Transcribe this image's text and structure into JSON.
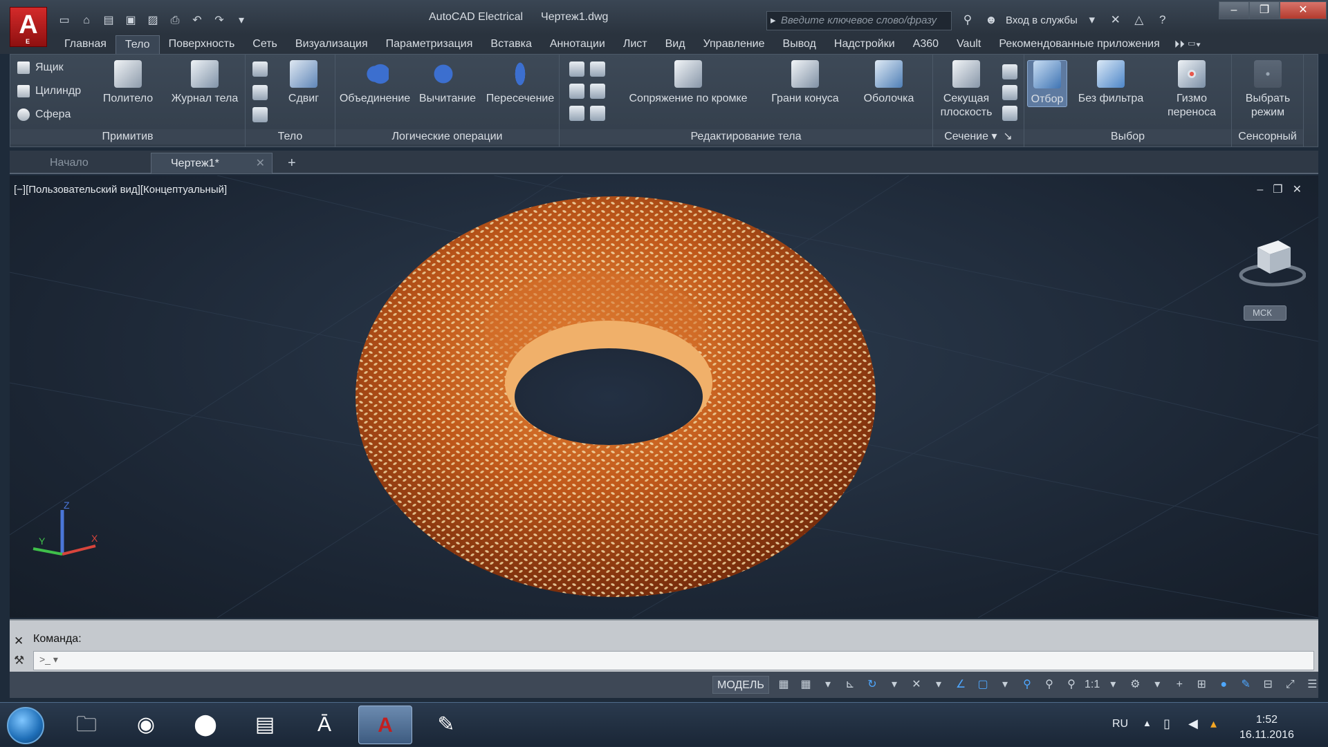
{
  "titlebar": {
    "app_name": "AutoCAD Electrical",
    "file_name": "Чертеж1.dwg",
    "search_placeholder": "Введите ключевое слово/фразу",
    "signin": "Вход в службы"
  },
  "menu": {
    "tabs": [
      "Главная",
      "Тело",
      "Поверхность",
      "Сеть",
      "Визуализация",
      "Параметризация",
      "Вставка",
      "Аннотации",
      "Лист",
      "Вид",
      "Управление",
      "Вывод",
      "Надстройки",
      "A360",
      "Vault",
      "Рекомендованные приложения"
    ],
    "active_index": 1
  },
  "ribbon": {
    "primitives": {
      "label": "Примитив",
      "box": "Ящик",
      "cylinder": "Цилиндр",
      "sphere": "Сфера",
      "polysolid": "Политело",
      "history": "Журнал тела"
    },
    "solid": {
      "label": "Тело",
      "extrude": "Сдвиг"
    },
    "boolean": {
      "label": "Логические операции",
      "union": "Объединение",
      "subtract": "Вычитание",
      "intersect": "Пересечение"
    },
    "edit": {
      "label": "Редактирование тела",
      "fillet": "Сопряжение по кромке",
      "taper": "Грани конуса",
      "shell": "Оболочка"
    },
    "section": {
      "label": "Сечение",
      "plane_line1": "Секущая",
      "plane_line2": "плоскость"
    },
    "selection": {
      "label": "Выбор",
      "culling": "Отбор",
      "no_filter": "Без фильтра",
      "gizmo_line1": "Гизмо",
      "gizmo_line2": "переноса"
    },
    "touch": {
      "label": "Сенсорный",
      "select_line1": "Выбрать",
      "select_line2": "режим"
    }
  },
  "doc_tabs": {
    "start": "Начало",
    "drawing": "Чертеж1*",
    "add": "+"
  },
  "viewport": {
    "label": "[−][Пользовательский вид][Концептуальный]",
    "wcs": "МСК"
  },
  "command": {
    "label": "Команда:"
  },
  "status": {
    "model": "МОДЕЛЬ",
    "scale": "1:1"
  },
  "taskbar": {
    "lang": "RU",
    "time": "1:52",
    "date": "16.11.2016"
  },
  "colors": {
    "ribbon_bg": "#38434f",
    "viewport_bg": "#1e2b3a",
    "accent_blue": "#4ea7ff",
    "bagel_crust": "#c0581a",
    "autocad_red": "#c21f1f"
  }
}
